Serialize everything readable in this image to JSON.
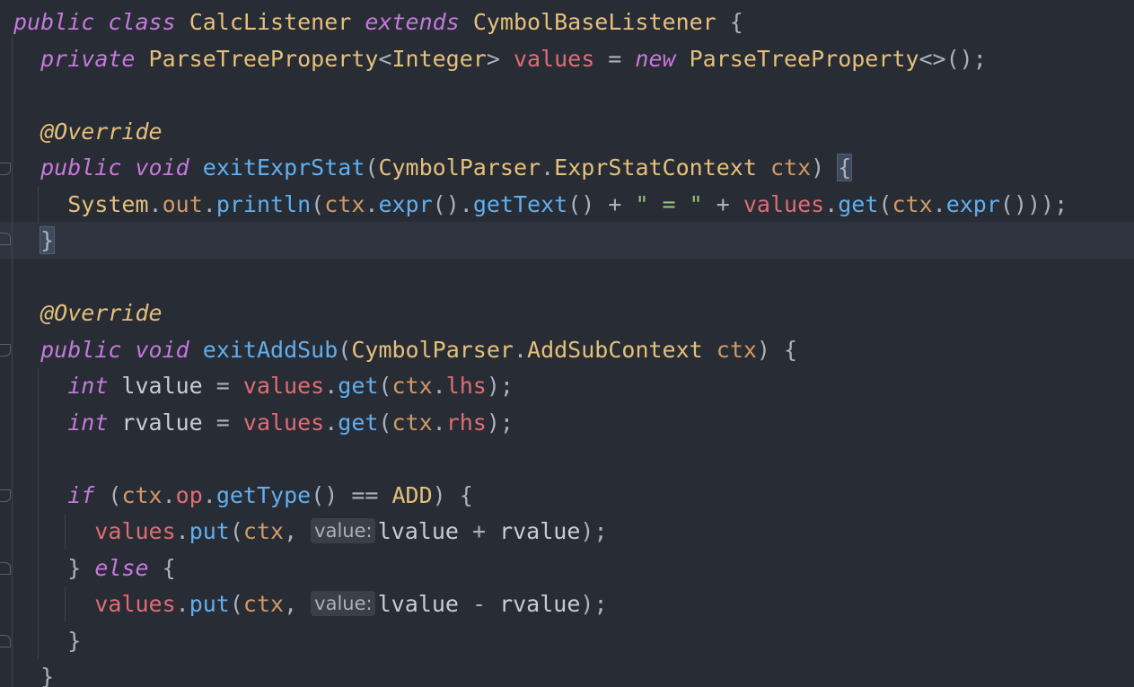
{
  "editor": {
    "language": "java",
    "theme_colors": {
      "background": "#282c34",
      "keyword": "#c678dd",
      "class": "#e5c07b",
      "field": "#e06c75",
      "method": "#61afef",
      "string": "#98c379",
      "parameter": "#d19a66",
      "current_line": "#2f3440"
    },
    "lines": [
      {
        "tokens": [
          [
            "kw",
            "public"
          ],
          [
            "op",
            " "
          ],
          [
            "kw",
            "class"
          ],
          [
            "op",
            " "
          ],
          [
            "cls",
            "CalcListener"
          ],
          [
            "op",
            " "
          ],
          [
            "kw",
            "extends"
          ],
          [
            "op",
            " "
          ],
          [
            "cls",
            "CymbolBaseListener"
          ],
          [
            "op",
            " {"
          ]
        ]
      },
      {
        "tokens": [
          [
            "op",
            "  "
          ],
          [
            "kw",
            "private"
          ],
          [
            "op",
            " "
          ],
          [
            "cls",
            "ParseTreeProperty"
          ],
          [
            "op",
            "<"
          ],
          [
            "cls",
            "Integer"
          ],
          [
            "op",
            "> "
          ],
          [
            "fld",
            "values"
          ],
          [
            "op",
            " = "
          ],
          [
            "kw",
            "new"
          ],
          [
            "op",
            " "
          ],
          [
            "cls",
            "ParseTreeProperty"
          ],
          [
            "op",
            "<>();"
          ]
        ]
      },
      {
        "tokens": []
      },
      {
        "tokens": [
          [
            "op",
            "  "
          ],
          [
            "ann",
            "@Override"
          ]
        ]
      },
      {
        "tokens": [
          [
            "op",
            "  "
          ],
          [
            "kw",
            "public"
          ],
          [
            "op",
            " "
          ],
          [
            "kw",
            "void"
          ],
          [
            "op",
            " "
          ],
          [
            "fn",
            "exitExprStat"
          ],
          [
            "op",
            "("
          ],
          [
            "cls",
            "CymbolParser"
          ],
          [
            "op",
            "."
          ],
          [
            "cls",
            "ExprStatContext"
          ],
          [
            "op",
            " "
          ],
          [
            "param",
            "ctx"
          ],
          [
            "op",
            ") "
          ],
          [
            "bracehl",
            "{"
          ]
        ]
      },
      {
        "tokens": [
          [
            "op",
            "    "
          ],
          [
            "cls",
            "System"
          ],
          [
            "op",
            "."
          ],
          [
            "param",
            "out"
          ],
          [
            "op",
            "."
          ],
          [
            "fn",
            "println"
          ],
          [
            "op",
            "("
          ],
          [
            "param",
            "ctx"
          ],
          [
            "op",
            "."
          ],
          [
            "fn",
            "expr"
          ],
          [
            "op",
            "()."
          ],
          [
            "fn",
            "getText"
          ],
          [
            "op",
            "() + "
          ],
          [
            "str",
            "\" = \""
          ],
          [
            "op",
            " + "
          ],
          [
            "fld",
            "values"
          ],
          [
            "op",
            "."
          ],
          [
            "fn",
            "get"
          ],
          [
            "op",
            "("
          ],
          [
            "param",
            "ctx"
          ],
          [
            "op",
            "."
          ],
          [
            "fn",
            "expr"
          ],
          [
            "op",
            "()));"
          ]
        ]
      },
      {
        "tokens": [
          [
            "op",
            "  "
          ],
          [
            "bracehl",
            "}"
          ]
        ]
      },
      {
        "tokens": []
      },
      {
        "tokens": [
          [
            "op",
            "  "
          ],
          [
            "ann",
            "@Override"
          ]
        ]
      },
      {
        "tokens": [
          [
            "op",
            "  "
          ],
          [
            "kw",
            "public"
          ],
          [
            "op",
            " "
          ],
          [
            "kw",
            "void"
          ],
          [
            "op",
            " "
          ],
          [
            "fn",
            "exitAddSub"
          ],
          [
            "op",
            "("
          ],
          [
            "cls",
            "CymbolParser"
          ],
          [
            "op",
            "."
          ],
          [
            "cls",
            "AddSubContext"
          ],
          [
            "op",
            " "
          ],
          [
            "param",
            "ctx"
          ],
          [
            "op",
            ") {"
          ]
        ]
      },
      {
        "tokens": [
          [
            "op",
            "    "
          ],
          [
            "kw",
            "int"
          ],
          [
            "pl",
            " lvalue"
          ],
          [
            "op",
            " = "
          ],
          [
            "fld",
            "values"
          ],
          [
            "op",
            "."
          ],
          [
            "fn",
            "get"
          ],
          [
            "op",
            "("
          ],
          [
            "param",
            "ctx"
          ],
          [
            "op",
            "."
          ],
          [
            "fld",
            "lhs"
          ],
          [
            "op",
            ");"
          ]
        ]
      },
      {
        "tokens": [
          [
            "op",
            "    "
          ],
          [
            "kw",
            "int"
          ],
          [
            "pl",
            " rvalue"
          ],
          [
            "op",
            " = "
          ],
          [
            "fld",
            "values"
          ],
          [
            "op",
            "."
          ],
          [
            "fn",
            "get"
          ],
          [
            "op",
            "("
          ],
          [
            "param",
            "ctx"
          ],
          [
            "op",
            "."
          ],
          [
            "fld",
            "rhs"
          ],
          [
            "op",
            ");"
          ]
        ]
      },
      {
        "tokens": []
      },
      {
        "tokens": [
          [
            "op",
            "    "
          ],
          [
            "kw",
            "if"
          ],
          [
            "op",
            " ("
          ],
          [
            "param",
            "ctx"
          ],
          [
            "op",
            "."
          ],
          [
            "fld",
            "op"
          ],
          [
            "op",
            "."
          ],
          [
            "fn",
            "getType"
          ],
          [
            "op",
            "() == "
          ],
          [
            "cls",
            "ADD"
          ],
          [
            "op",
            ") {"
          ]
        ]
      },
      {
        "tokens": [
          [
            "op",
            "      "
          ],
          [
            "fld",
            "values"
          ],
          [
            "op",
            "."
          ],
          [
            "fn",
            "put"
          ],
          [
            "op",
            "("
          ],
          [
            "param",
            "ctx"
          ],
          [
            "op",
            ", "
          ],
          [
            "hint",
            "value:"
          ],
          [
            "pl",
            "lvalue"
          ],
          [
            "op",
            " + "
          ],
          [
            "pl",
            "rvalue"
          ],
          [
            "op",
            ");"
          ]
        ]
      },
      {
        "tokens": [
          [
            "op",
            "    } "
          ],
          [
            "kw",
            "else"
          ],
          [
            "op",
            " {"
          ]
        ]
      },
      {
        "tokens": [
          [
            "op",
            "      "
          ],
          [
            "fld",
            "values"
          ],
          [
            "op",
            "."
          ],
          [
            "fn",
            "put"
          ],
          [
            "op",
            "("
          ],
          [
            "param",
            "ctx"
          ],
          [
            "op",
            ", "
          ],
          [
            "hint",
            "value:"
          ],
          [
            "pl",
            "lvalue"
          ],
          [
            "op",
            " - "
          ],
          [
            "pl",
            "rvalue"
          ],
          [
            "op",
            ");"
          ]
        ]
      },
      {
        "tokens": [
          [
            "op",
            "    }"
          ]
        ]
      },
      {
        "tokens": [
          [
            "op",
            "  }"
          ]
        ]
      }
    ]
  }
}
